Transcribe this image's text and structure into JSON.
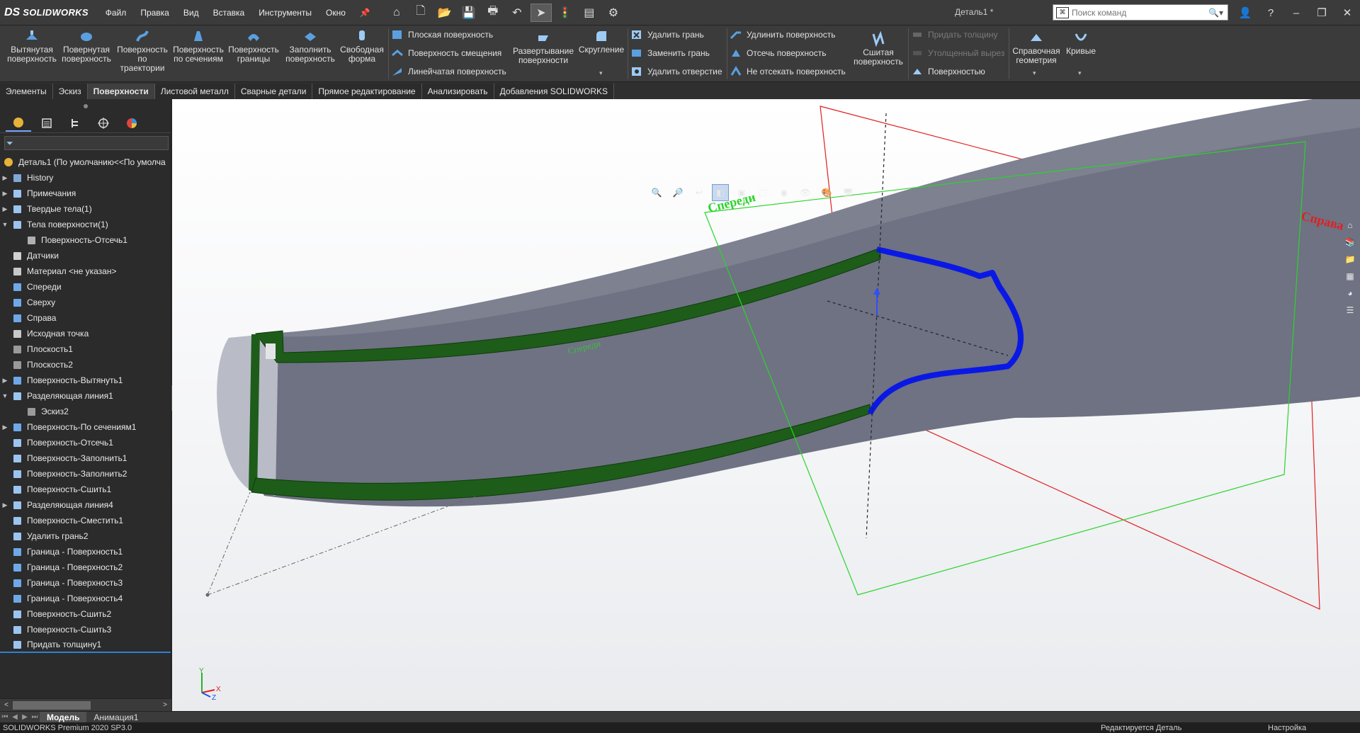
{
  "app": {
    "logo_mark": "DS",
    "logo_text": "SOLIDWORKS",
    "document_title": "Деталь1 *"
  },
  "menu": [
    "Файл",
    "Правка",
    "Вид",
    "Вставка",
    "Инструменты",
    "Окно"
  ],
  "search": {
    "placeholder": "Поиск команд",
    "prefix": "⌘"
  },
  "ribbon": {
    "large_buttons": [
      "Вытянутая поверхность",
      "Повернутая поверхность",
      "Поверхность по траектории",
      "Поверхность по сечениям",
      "Поверхность границы",
      "Заполнить поверхность",
      "Свободная форма"
    ],
    "group1": [
      "Плоская поверхность",
      "Поверхность смещения",
      "Линейчатая поверхность"
    ],
    "unroll_button": "Развертывание поверхности",
    "fillet_button": "Скругление",
    "group2": [
      "Удалить грань",
      "Заменить грань",
      "Удалить отверстие"
    ],
    "group3": [
      "Удлинить поверхность",
      "Отсечь поверхность",
      "Не отсекать поверхность"
    ],
    "knit_button": "Сшитая поверхность",
    "group4": [
      "Придать толщину",
      "Утолщенный вырез",
      "Поверхностью"
    ],
    "ref_geometry": "Справочная геометрия",
    "curves": "Кривые"
  },
  "tabs": [
    "Элементы",
    "Эскиз",
    "Поверхности",
    "Листовой металл",
    "Сварные детали",
    "Прямое редактирование",
    "Анализировать",
    "Добавления SOLIDWORKS"
  ],
  "active_tab": "Поверхности",
  "feature_tree": {
    "root": "Деталь1  (По умолчанию<<По умолча",
    "items": [
      {
        "label": "History",
        "arrow": "▶",
        "indent": 0,
        "icon": "history-icon"
      },
      {
        "label": "Примечания",
        "arrow": "▶",
        "indent": 0,
        "icon": "annotations-icon"
      },
      {
        "label": "Твердые тела(1)",
        "arrow": "▶",
        "indent": 0,
        "icon": "solid-bodies-icon"
      },
      {
        "label": "Тела поверхности(1)",
        "arrow": "▼",
        "indent": 0,
        "icon": "surface-bodies-icon"
      },
      {
        "label": "Поверхность-Отсечь1",
        "arrow": "",
        "indent": 1,
        "icon": "surface-body-icon"
      },
      {
        "label": "Датчики",
        "arrow": "",
        "indent": 0,
        "icon": "sensors-icon"
      },
      {
        "label": "Материал <не указан>",
        "arrow": "",
        "indent": 0,
        "icon": "material-icon"
      },
      {
        "label": "Спереди",
        "arrow": "",
        "indent": 0,
        "icon": "plane-icon"
      },
      {
        "label": "Сверху",
        "arrow": "",
        "indent": 0,
        "icon": "plane-icon"
      },
      {
        "label": "Справа",
        "arrow": "",
        "indent": 0,
        "icon": "plane-icon"
      },
      {
        "label": "Исходная точка",
        "arrow": "",
        "indent": 0,
        "icon": "origin-icon"
      },
      {
        "label": "Плоскость1",
        "arrow": "",
        "indent": 0,
        "icon": "plane-gray-icon"
      },
      {
        "label": "Плоскость2",
        "arrow": "",
        "indent": 0,
        "icon": "plane-gray-icon"
      },
      {
        "label": "Поверхность-Вытянуть1",
        "arrow": "▶",
        "indent": 0,
        "icon": "extrude-surface-icon"
      },
      {
        "label": "Разделяющая линия1",
        "arrow": "▼",
        "indent": 0,
        "icon": "split-line-icon"
      },
      {
        "label": "Эскиз2",
        "arrow": "",
        "indent": 1,
        "icon": "sketch-icon"
      },
      {
        "label": "Поверхность-По сечениям1",
        "arrow": "▶",
        "indent": 0,
        "icon": "loft-surface-icon"
      },
      {
        "label": "Поверхность-Отсечь1",
        "arrow": "",
        "indent": 0,
        "icon": "trim-surface-icon"
      },
      {
        "label": "Поверхность-Заполнить1",
        "arrow": "",
        "indent": 0,
        "icon": "fill-surface-icon"
      },
      {
        "label": "Поверхность-Заполнить2",
        "arrow": "",
        "indent": 0,
        "icon": "fill-surface-icon"
      },
      {
        "label": "Поверхность-Сшить1",
        "arrow": "",
        "indent": 0,
        "icon": "knit-surface-icon"
      },
      {
        "label": "Разделяющая линия4",
        "arrow": "▶",
        "indent": 0,
        "icon": "split-line-icon"
      },
      {
        "label": "Поверхность-Сместить1",
        "arrow": "",
        "indent": 0,
        "icon": "offset-surface-icon"
      },
      {
        "label": "Удалить грань2",
        "arrow": "",
        "indent": 0,
        "icon": "delete-face-icon"
      },
      {
        "label": "Граница - Поверхность1",
        "arrow": "",
        "indent": 0,
        "icon": "boundary-surface-icon"
      },
      {
        "label": "Граница - Поверхность2",
        "arrow": "",
        "indent": 0,
        "icon": "boundary-surface-icon"
      },
      {
        "label": "Граница - Поверхность3",
        "arrow": "",
        "indent": 0,
        "icon": "boundary-surface-icon"
      },
      {
        "label": "Граница - Поверхность4",
        "arrow": "",
        "indent": 0,
        "icon": "boundary-surface-icon"
      },
      {
        "label": "Поверхность-Сшить2",
        "arrow": "",
        "indent": 0,
        "icon": "knit-surface-icon"
      },
      {
        "label": "Поверхность-Сшить3",
        "arrow": "",
        "indent": 0,
        "icon": "knit-surface-icon"
      },
      {
        "label": "Придать толщину1",
        "arrow": "",
        "indent": 0,
        "icon": "thicken-icon"
      }
    ]
  },
  "viewport": {
    "plane_front_label": "Спереди",
    "plane_right_label": "Справа",
    "surface_text": "Спереди",
    "triad": {
      "y": "Y",
      "x": "X",
      "z": "Z"
    },
    "colors": {
      "front_plane": "#2bd42b",
      "right_plane": "#e02020",
      "edge_blue": "#0a18e6",
      "edge_green": "#1e5c1a",
      "body": "#6e7282"
    }
  },
  "bottom_tabs": [
    "Модель",
    "Анимация1"
  ],
  "status": {
    "version": "SOLIDWORKS Premium 2020 SP3.0",
    "editing": "Редактируется Деталь",
    "settings": "Настройка"
  }
}
